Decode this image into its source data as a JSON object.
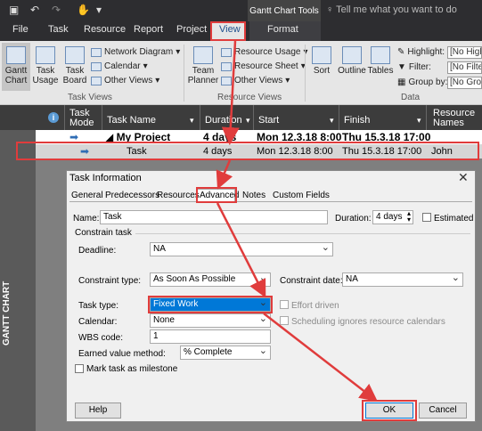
{
  "titlebar": {
    "tools_header": "Gantt Chart Tools",
    "tell_me": "Tell me what you want to do"
  },
  "tabs": [
    {
      "label": "File"
    },
    {
      "label": "Task"
    },
    {
      "label": "Resource"
    },
    {
      "label": "Report"
    },
    {
      "label": "Project"
    },
    {
      "label": "View"
    },
    {
      "label": "Format"
    }
  ],
  "ribbon": {
    "task_views": {
      "label": "Task Views",
      "gantt_chart": "Gantt\nChart",
      "task_usage": "Task\nUsage",
      "task_board": "Task\nBoard",
      "network_diagram": "Network Diagram",
      "calendar": "Calendar",
      "other_views": "Other Views"
    },
    "resource_views": {
      "label": "Resource Views",
      "team_planner": "Team\nPlanner",
      "resource_usage": "Resource Usage",
      "resource_sheet": "Resource Sheet",
      "other_views": "Other Views"
    },
    "data": {
      "label": "Data",
      "sort": "Sort",
      "outline": "Outline",
      "tables": "Tables",
      "highlight_label": "Highlight:",
      "highlight_value": "[No Highlight]",
      "filter_label": "Filter:",
      "filter_value": "[No Filter]",
      "group_label": "Group by:",
      "group_value": "[No Group]"
    }
  },
  "grid": {
    "headers": {
      "info": "",
      "mode": "Task\nMode",
      "name": "Task Name",
      "duration": "Duration",
      "start": "Start",
      "finish": "Finish",
      "resource": "Resource\nNames"
    },
    "rows": [
      {
        "id": "0",
        "name": "My Project",
        "duration": "4 days",
        "start": "Mon 12.3.18 8:00",
        "finish": "Thu 15.3.18 17:00",
        "resource": ""
      },
      {
        "id": "1",
        "name": "Task",
        "duration": "4 days",
        "start": "Mon 12.3.18 8:00",
        "finish": "Thu 15.3.18 17:00",
        "resource": "John"
      }
    ],
    "side_label": "GANTT CHART"
  },
  "dialog": {
    "title": "Task Information",
    "tabs": [
      "General",
      "Predecessors",
      "Resources",
      "Advanced",
      "Notes",
      "Custom Fields"
    ],
    "name_label": "Name:",
    "name_value": "Task",
    "duration_label": "Duration:",
    "duration_value": "4 days",
    "estimated_label": "Estimated",
    "constrain_section": "Constrain task",
    "deadline_label": "Deadline:",
    "deadline_value": "NA",
    "constraint_type_label": "Constraint type:",
    "constraint_type_value": "As Soon As Possible",
    "constraint_date_label": "Constraint date:",
    "constraint_date_value": "NA",
    "task_type_label": "Task type:",
    "task_type_value": "Fixed Work",
    "effort_driven_label": "Effort driven",
    "calendar_label": "Calendar:",
    "calendar_value": "None",
    "scheduling_ignores_label": "Scheduling ignores resource calendars",
    "wbs_label": "WBS code:",
    "wbs_value": "1",
    "earned_value_label": "Earned value method:",
    "earned_value_value": "% Complete",
    "milestone_label": "Mark task as milestone",
    "help_button": "Help",
    "ok_button": "OK",
    "cancel_button": "Cancel"
  },
  "colors": {
    "highlight_red": "#e03c3c",
    "selection_blue": "#0078d7"
  }
}
